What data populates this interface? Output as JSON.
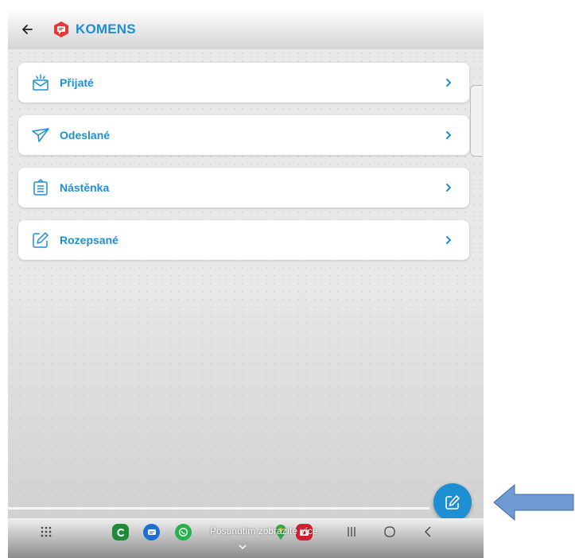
{
  "app": {
    "title": "KOMENS"
  },
  "colors": {
    "accent": "#1e8fd2",
    "logo_red": "#e53939",
    "pointer_blue": "#6f9bd3"
  },
  "menu": {
    "items": [
      {
        "label": "Přijaté",
        "icon": "inbox-icon"
      },
      {
        "label": "Odeslané",
        "icon": "paper-plane-icon"
      },
      {
        "label": "Nástěnka",
        "icon": "notice-board-icon"
      },
      {
        "label": "Rozepsané",
        "icon": "edit-icon"
      }
    ]
  },
  "fab": {
    "icon": "compose-icon"
  },
  "navbar": {
    "hint": "Posunutím zobrazíte více",
    "apps": [
      "app-drawer-icon",
      "caller-app-icon",
      "messages-app-icon",
      "whatsapp-icon",
      "maps-icon",
      "camera-app-icon"
    ],
    "buttons": [
      "recent-apps-icon",
      "home-icon",
      "back-nav-icon"
    ]
  }
}
